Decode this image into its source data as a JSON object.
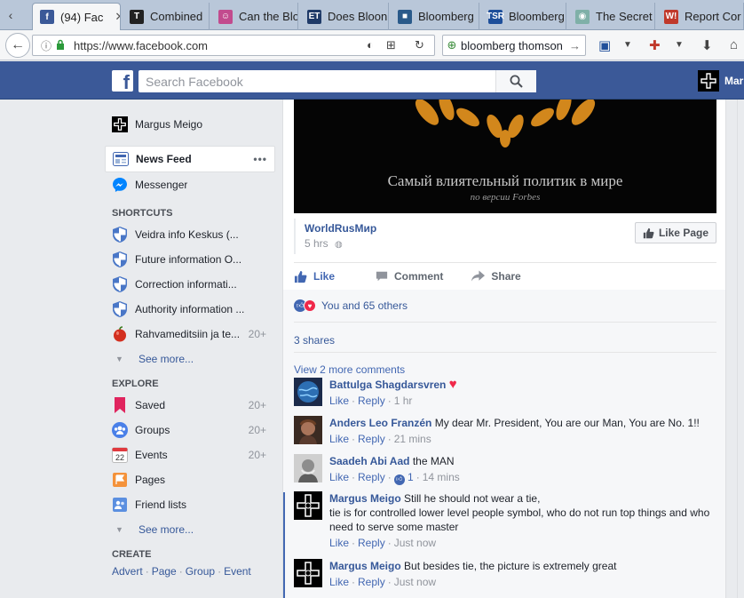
{
  "browser": {
    "tabs": [
      {
        "label": "(94) Fac",
        "fav": "f",
        "fav_color": "#3b5998",
        "active": true
      },
      {
        "label": "Combined",
        "fav": "T",
        "fav_color": "#222222"
      },
      {
        "label": "Can the Blo",
        "fav": "☺",
        "fav_color": "#c24b8e"
      },
      {
        "label": "Does Bloon",
        "fav": "ET",
        "fav_color": "#1f3a68"
      },
      {
        "label": "Bloomberg",
        "fav": "■",
        "fav_color": "#2a5a8a"
      },
      {
        "label": "Bloomberg",
        "fav": "TSR",
        "fav_color": "#1e4f9a"
      },
      {
        "label": "The Secret",
        "fav": "◉",
        "fav_color": "#7fb0a8"
      },
      {
        "label": "Report Cor",
        "fav": "W!",
        "fav_color": "#c0392b"
      }
    ],
    "url": "https://www.facebook.com",
    "search_value": "bloomberg thomson"
  },
  "fb": {
    "search_placeholder": "Search Facebook",
    "user_short": "Mar"
  },
  "sidebar": {
    "profile_name": "Margus Meigo",
    "news_feed": "News Feed",
    "news_feed_more": "•••",
    "messenger": "Messenger",
    "shortcuts_heading": "SHORTCUTS",
    "shortcuts": [
      {
        "label": "Veidra info Keskus (...",
        "count": ""
      },
      {
        "label": "Future information O...",
        "count": ""
      },
      {
        "label": "Correction informati...",
        "count": ""
      },
      {
        "label": "Authority information ...",
        "count": ""
      },
      {
        "label": "Rahvameditsiin ja te...",
        "count": "20+"
      }
    ],
    "see_more_1": "See more...",
    "explore_heading": "EXPLORE",
    "explore": [
      {
        "label": "Saved",
        "count": "20+",
        "icon": "bookmark-icon"
      },
      {
        "label": "Groups",
        "count": "20+",
        "icon": "groups-icon"
      },
      {
        "label": "Events",
        "count": "20+",
        "icon": "calendar-icon",
        "day": "22"
      },
      {
        "label": "Pages",
        "count": "",
        "icon": "flag-icon"
      },
      {
        "label": "Friend lists",
        "count": "",
        "icon": "friend-list-icon"
      }
    ],
    "see_more_2": "See more...",
    "create_heading": "CREATE",
    "create_links": [
      "Advert",
      "Page",
      "Group",
      "Event"
    ],
    "create_sep": "·"
  },
  "post": {
    "image_caption": "Самый влиятельный политик в мире",
    "image_sub": "по версии Forbes",
    "source": "WorldRusМир",
    "time": "5 hrs",
    "like_page": "Like Page",
    "actions": {
      "like": "Like",
      "comment": "Comment",
      "share": "Share"
    },
    "reactions_text": "You and 65 others",
    "shares": "3 shares",
    "view_more": "View 2 more comments",
    "comments": [
      {
        "author": "Battulga Shagdarsvren",
        "text": "",
        "like": "Like",
        "reply": "Reply",
        "time": "1 hr",
        "heart": true,
        "avatar": "globe"
      },
      {
        "author": "Anders Leo Franzén",
        "text": "My dear Mr. President, You are our Man, You are No. 1!!",
        "like": "Like",
        "reply": "Reply",
        "time": "21 mins",
        "avatar": "face"
      },
      {
        "author": "Saadeh Abi Aad",
        "text": "the MAN",
        "like": "Like",
        "reply": "Reply",
        "time": "14 mins",
        "likes": "1",
        "avatar": "gray"
      },
      {
        "author": "Margus Meigo",
        "text": "Still he should not wear a tie,\ntie is for controlled lower level people symbol, who do not run top things and who need to serve some master",
        "like": "Like",
        "reply": "Reply",
        "time": "Just now",
        "avatar": "cross"
      },
      {
        "author": "Margus Meigo",
        "text": "But besides tie, the picture is extremely great",
        "like": "Like",
        "reply": "Reply",
        "time": "Just now",
        "avatar": "cross"
      }
    ],
    "colors": {
      "link": "#365899",
      "accent": "#4267b2",
      "muted": "#90949c"
    }
  }
}
